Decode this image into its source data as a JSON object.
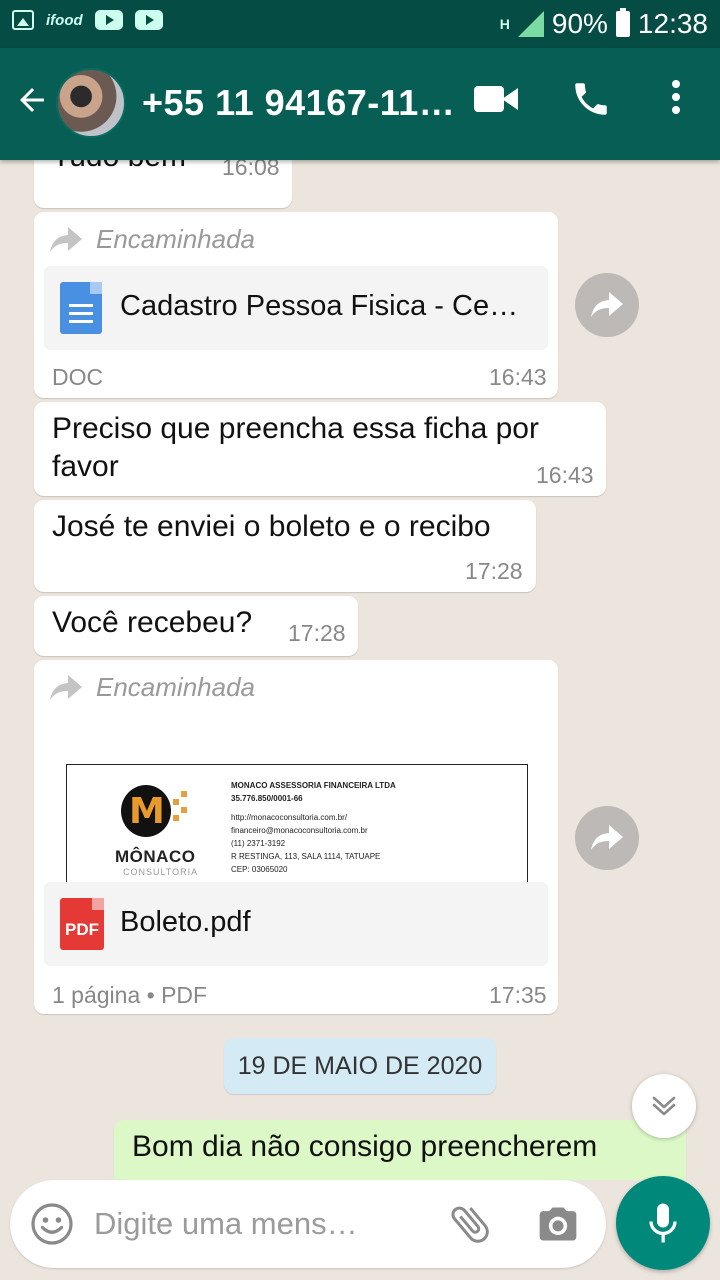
{
  "status_bar": {
    "left_icons": [
      "image-icon",
      "ifood-icon",
      "youtube-icon",
      "youtube-icon"
    ],
    "ifood_label": "ifood",
    "network_label": "H",
    "battery": "90%",
    "time": "12:38"
  },
  "header": {
    "contact": "+55 11 94167-11…",
    "icons": [
      "back-arrow-icon",
      "video-call-icon",
      "phone-icon",
      "more-vert-icon"
    ]
  },
  "messages": [
    {
      "text": "Tudo bem",
      "time": "16:08"
    },
    {
      "forwarded_label": "Encaminhada",
      "doc_name": "Cadastro Pessoa Fisica - Ce…",
      "doc_type": "DOC",
      "time": "16:43"
    },
    {
      "text_line1": "Preciso que preencha essa ficha por",
      "text_line2": "favor",
      "time": "16:43"
    },
    {
      "text": "José te enviei o boleto e o recibo",
      "time": "17:28"
    },
    {
      "text": "Você recebeu?",
      "time": "17:28"
    },
    {
      "forwarded_label": "Encaminhada",
      "preview": {
        "brand": "MÔNACO",
        "brand_sub": "CONSULTORIA",
        "company": "MONACO ASSESSORIA FINANCEIRA LTDA",
        "cnpj": "35.776.850/0001-66",
        "site": "http://monacoconsultoria.com.br/",
        "email": "financeiro@monacoconsultoria.com.br",
        "phone": "(11) 2371-3192",
        "address": "R RESTINGA, 113, SALA 1114, TATUAPE",
        "cep": "CEP: 03065020"
      },
      "doc_name": "Boleto.pdf",
      "pdf_label": "PDF",
      "meta": "1 página • PDF",
      "time": "17:35"
    }
  ],
  "date_chip": "19 DE MAIO DE 2020",
  "outgoing_message": "Bom dia não consigo preencherem",
  "input": {
    "placeholder": "Digite uma mens…"
  },
  "colors": {
    "header": "#075e54",
    "status_bar": "#054d44",
    "chat_bg": "#ece5dd",
    "outgoing_bubble": "#dcf8c6",
    "date_chip": "#d4eaf4",
    "mic_button": "#00897b"
  }
}
